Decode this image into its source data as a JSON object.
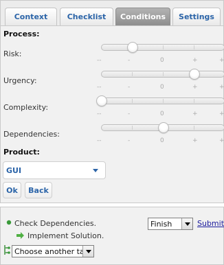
{
  "tabs": [
    {
      "label": "Context",
      "active": false
    },
    {
      "label": "Checklist",
      "active": false
    },
    {
      "label": "Conditions",
      "active": true
    },
    {
      "label": "Settings",
      "active": false
    }
  ],
  "process": {
    "heading": "Process:",
    "scale_labels": [
      "--",
      "-",
      "0",
      "+",
      "++"
    ],
    "sliders": [
      {
        "label": "Risk:",
        "level": "-"
      },
      {
        "label": "Urgency:",
        "level": "+"
      },
      {
        "label": "Complexity:",
        "level": "--"
      },
      {
        "label": "Dependencies:",
        "level": "0"
      }
    ]
  },
  "product": {
    "heading": "Product:",
    "selected": "GUI"
  },
  "buttons": {
    "ok": "Ok",
    "back": "Back"
  },
  "tasks": {
    "current": "Check Dependencies.",
    "next": "Implement Solution.",
    "status_select": "Finish",
    "submit_label": "Submit",
    "other_task_select": "Choose another task"
  },
  "colors": {
    "accent_blue": "#2b64a8",
    "active_tab": "#9a9a9a",
    "green_bullet": "#3a9a3a"
  }
}
